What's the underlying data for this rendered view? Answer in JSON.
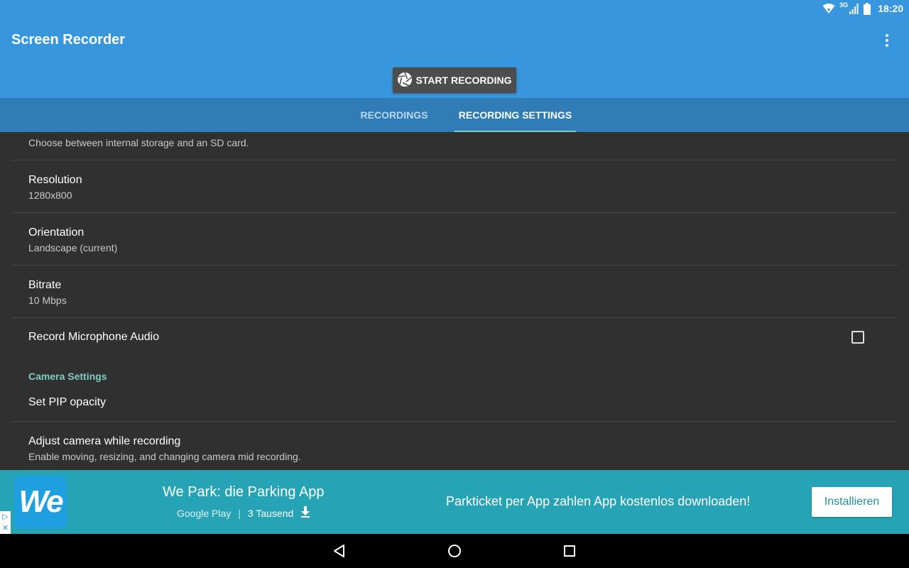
{
  "status_bar": {
    "network": "3G",
    "time": "18:20",
    "icons": [
      "wifi-icon",
      "signal-icon",
      "battery-icon"
    ]
  },
  "app_bar": {
    "title": "Screen Recorder",
    "record_button_label": "START RECORDING",
    "record_button_icon": "shutter-icon",
    "overflow_icon": "more-vert-icon"
  },
  "tabs": [
    {
      "label": "RECORDINGS",
      "selected": false
    },
    {
      "label": "RECORDING SETTINGS",
      "selected": true
    }
  ],
  "settings": {
    "storage": {
      "summary": "Choose between internal storage and an SD card."
    },
    "resolution": {
      "title": "Resolution",
      "summary": "1280x800"
    },
    "orientation": {
      "title": "Orientation",
      "summary": "Landscape (current)"
    },
    "bitrate": {
      "title": "Bitrate",
      "summary": "10 Mbps"
    },
    "microphone": {
      "title": "Record Microphone Audio",
      "checked": false
    },
    "camera_category": "Camera Settings",
    "pip_opacity": {
      "title": "Set PIP opacity"
    },
    "adjust_camera": {
      "title": "Adjust camera while recording",
      "summary": "Enable moving, resizing, and changing camera mid recording."
    }
  },
  "ad": {
    "logo_text": "We",
    "app_title": "We Park: die Parking App",
    "store": "Google Play",
    "separator": "|",
    "downloads": "3 Tausend",
    "description": "Parkticket per App zahlen App kostenlos downloaden!",
    "install_label": "Installieren"
  },
  "colors": {
    "app_bar": "#3796dc",
    "tab_bar": "#2f7cb7",
    "accent": "#80cbc4",
    "background": "#303030",
    "ad_background": "#26a3b5"
  }
}
